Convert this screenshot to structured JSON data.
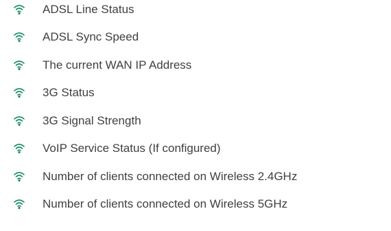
{
  "accent_color": "#1d8a6d",
  "icon_name": "wireless-signal-icon",
  "items": [
    {
      "label": "ADSL Line Status"
    },
    {
      "label": "ADSL Sync Speed"
    },
    {
      "label": "The current WAN IP Address"
    },
    {
      "label": "3G Status"
    },
    {
      "label": "3G Signal Strength"
    },
    {
      "label": "VoIP Service Status (If configured)"
    },
    {
      "label": "Number of clients connected on Wireless 2.4GHz"
    },
    {
      "label": "Number of clients connected on Wireless 5GHz"
    }
  ]
}
